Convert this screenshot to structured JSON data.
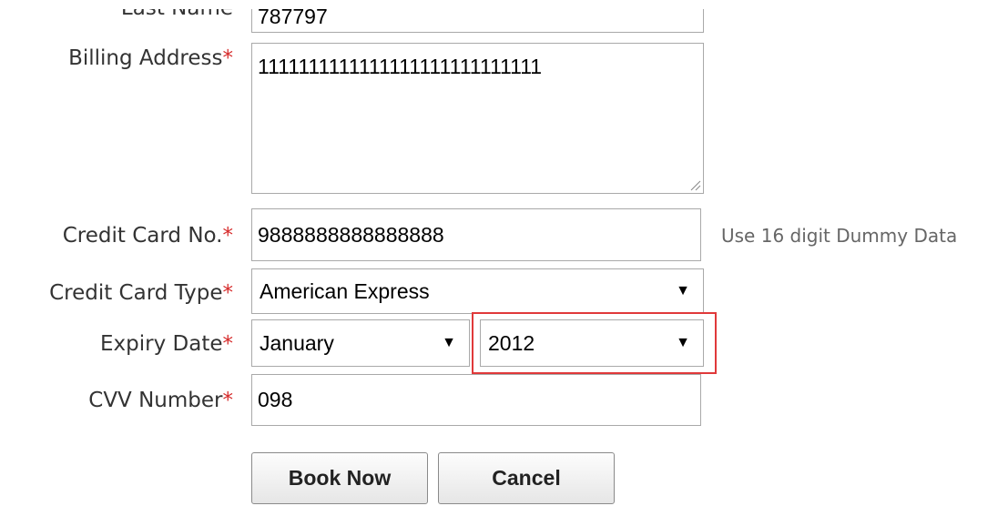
{
  "form": {
    "last_name": {
      "label": "Last Name",
      "value": "787797"
    },
    "billing_address": {
      "label": "Billing Address",
      "required_mark": "*",
      "value": "1111111111111111111111111111"
    },
    "credit_card_no": {
      "label": "Credit Card No.",
      "required_mark": "*",
      "value": "9888888888888888",
      "hint": "Use 16 digit Dummy Data"
    },
    "credit_card_type": {
      "label": "Credit Card Type",
      "required_mark": "*",
      "selected": "American Express"
    },
    "expiry_date": {
      "label": "Expiry Date",
      "required_mark": "*",
      "month_selected": "January",
      "year_selected": "2012"
    },
    "cvv_number": {
      "label": "CVV Number",
      "required_mark": "*",
      "value": "098"
    },
    "buttons": {
      "book_now": "Book Now",
      "cancel": "Cancel"
    }
  },
  "icons": {
    "dropdown_arrow": "▼",
    "resize_handle": "resize-grip-icon"
  },
  "colors": {
    "required_mark": "#d62b2b",
    "highlight_box": "#e0393a",
    "hint_text": "#666666",
    "field_border": "#a9a9a9"
  }
}
